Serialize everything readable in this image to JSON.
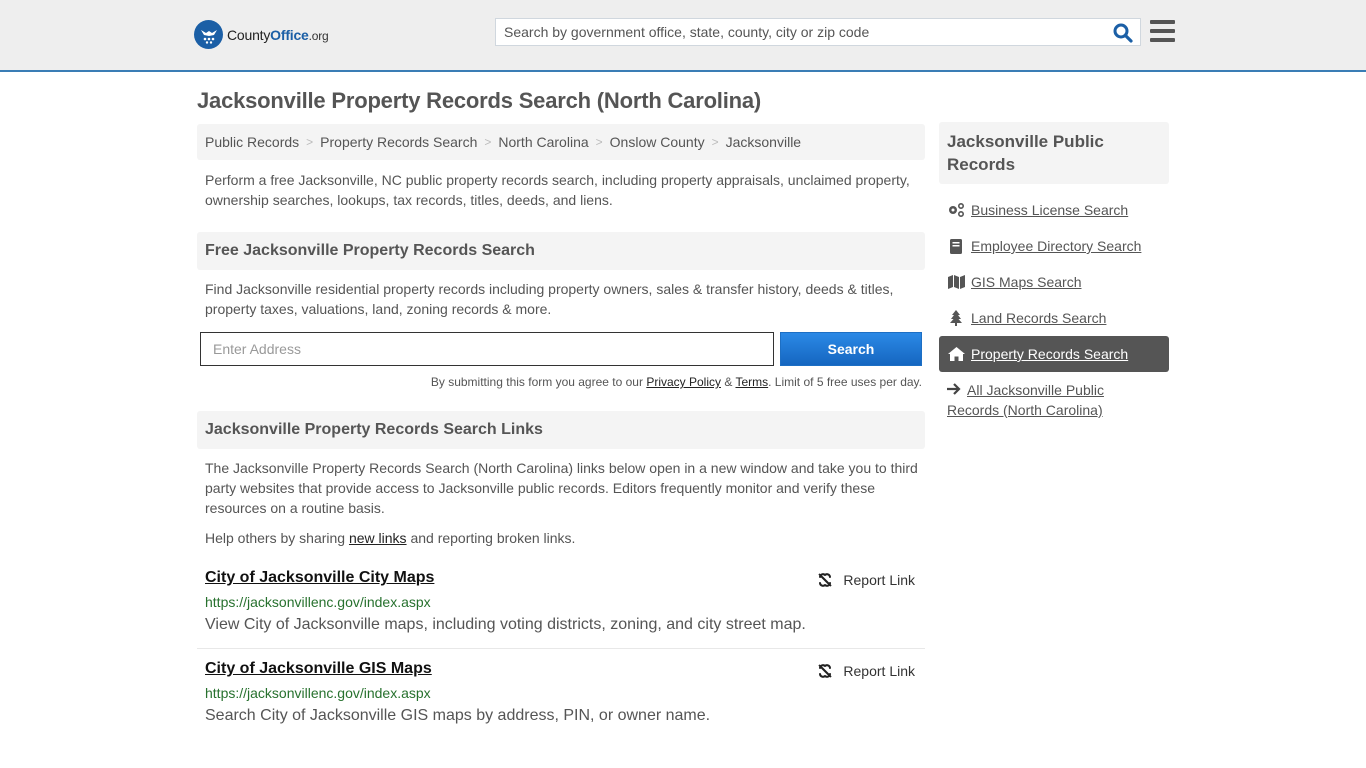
{
  "header": {
    "logo_text_main": "County",
    "logo_text_accent": "Office",
    "logo_text_tld": ".org",
    "search_placeholder": "Search by government office, state, county, city or zip code",
    "search_icon": "search-icon",
    "menu_icon": "hamburger-menu-icon"
  },
  "page": {
    "title": "Jacksonville Property Records Search (North Carolina)"
  },
  "breadcrumb": [
    {
      "label": "Public Records"
    },
    {
      "label": "Property Records Search"
    },
    {
      "label": "North Carolina"
    },
    {
      "label": "Onslow County"
    },
    {
      "label": "Jacksonville"
    }
  ],
  "breadcrumb_separator": ">",
  "intro": "Perform a free Jacksonville, NC public property records search, including property appraisals, unclaimed property, ownership searches, lookups, tax records, titles, deeds, and liens.",
  "free_search": {
    "heading": "Free Jacksonville Property Records Search",
    "description": "Find Jacksonville residential property records including property owners, sales & transfer history, deeds & titles, property taxes, valuations, land, zoning records & more.",
    "input_placeholder": "Enter Address",
    "input_value": "",
    "button_label": "Search",
    "disclaimer_prefix": "By submitting this form you agree to our ",
    "privacy_label": "Privacy Policy",
    "disclaimer_amp": " & ",
    "terms_label": "Terms",
    "disclaimer_suffix": ". Limit of 5 free uses per day."
  },
  "links_section": {
    "heading": "Jacksonville Property Records Search Links",
    "description": "The Jacksonville Property Records Search (North Carolina) links below open in a new window and take you to third party websites that provide access to Jacksonville public records. Editors frequently monitor and verify these resources on a routine basis.",
    "help_prefix": "Help others by sharing ",
    "help_link": "new links",
    "help_suffix": " and reporting broken links.",
    "report_label": "Report Link",
    "items": [
      {
        "title": "City of Jacksonville City Maps",
        "url": "https://jacksonvillenc.gov/index.aspx",
        "description": "View City of Jacksonville maps, including voting districts, zoning, and city street map."
      },
      {
        "title": "City of Jacksonville GIS Maps",
        "url": "https://jacksonvillenc.gov/index.aspx",
        "description": "Search City of Jacksonville GIS maps by address, PIN, or owner name."
      }
    ]
  },
  "sidebar": {
    "heading": "Jacksonville Public Records",
    "items": [
      {
        "label": "Business License Search",
        "icon": "gears-icon",
        "active": false
      },
      {
        "label": "Employee Directory Search",
        "icon": "book-icon",
        "active": false
      },
      {
        "label": "GIS Maps Search",
        "icon": "map-icon",
        "active": false
      },
      {
        "label": "Land Records Search",
        "icon": "tree-icon",
        "active": false
      },
      {
        "label": "Property Records Search",
        "icon": "home-icon",
        "active": true
      }
    ],
    "all_link": "All Jacksonville Public Records (North Carolina)",
    "all_icon": "arrow-right-icon"
  },
  "colors": {
    "brand_blue": "#1b5fa6",
    "header_border": "#3a7db5",
    "button_blue": "#1d6fc4",
    "url_green": "#27712e",
    "active_sidebar": "#555555"
  }
}
